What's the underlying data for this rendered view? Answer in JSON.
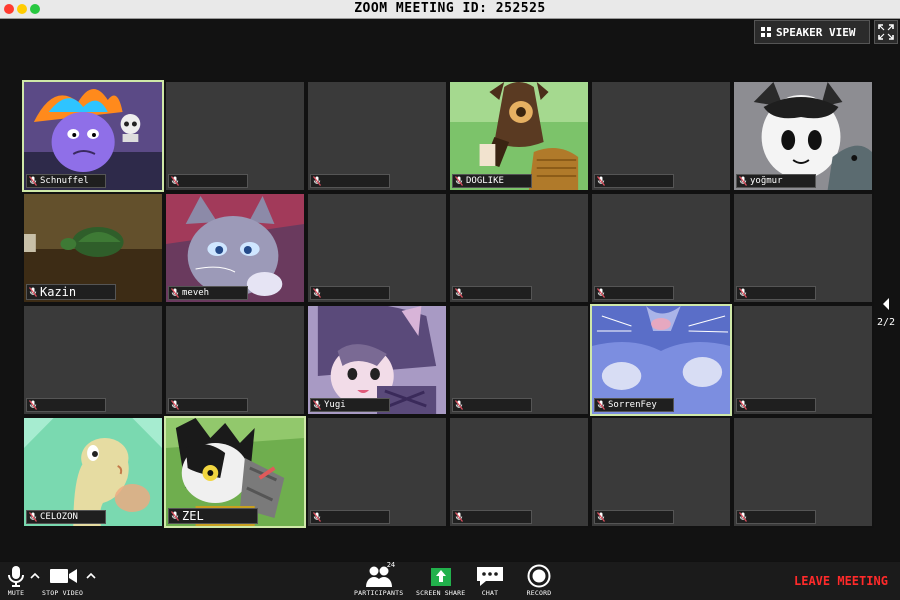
{
  "window": {
    "title": "ZOOM MEETING ID: 252525"
  },
  "header": {
    "speaker_view_label": "SPEAKER VIEW"
  },
  "colors": {
    "active_border": "#cfe8a8",
    "leave": "#ff2a2a",
    "empty_tile": "#3a3a3a",
    "muted_mic": "#e05060"
  },
  "participants": [
    {
      "name": "Schnuffel",
      "active": true
    },
    {
      "name": ""
    },
    {
      "name": ""
    },
    {
      "name": "DOGLIKE"
    },
    {
      "name": ""
    },
    {
      "name": "yoğmur"
    },
    {
      "name": "Kazin"
    },
    {
      "name": "meveh"
    },
    {
      "name": ""
    },
    {
      "name": ""
    },
    {
      "name": ""
    },
    {
      "name": ""
    },
    {
      "name": ""
    },
    {
      "name": ""
    },
    {
      "name": "Yugi"
    },
    {
      "name": ""
    },
    {
      "name": "SorrenFey",
      "active": true
    },
    {
      "name": ""
    },
    {
      "name": "CELOZON"
    },
    {
      "name": "ZEL",
      "active": true
    },
    {
      "name": ""
    },
    {
      "name": ""
    },
    {
      "name": ""
    },
    {
      "name": ""
    }
  ],
  "pager": {
    "label": "2/2"
  },
  "toolbar": {
    "mute_label": "MUTE",
    "stop_video_label": "STOP VIDEO",
    "participants_label": "PARTICIPANTS",
    "participants_count": "24",
    "screen_share_label": "SCREEN SHARE",
    "chat_label": "CHAT",
    "record_label": "RECORD",
    "leave_label": "LEAVE MEETING"
  }
}
